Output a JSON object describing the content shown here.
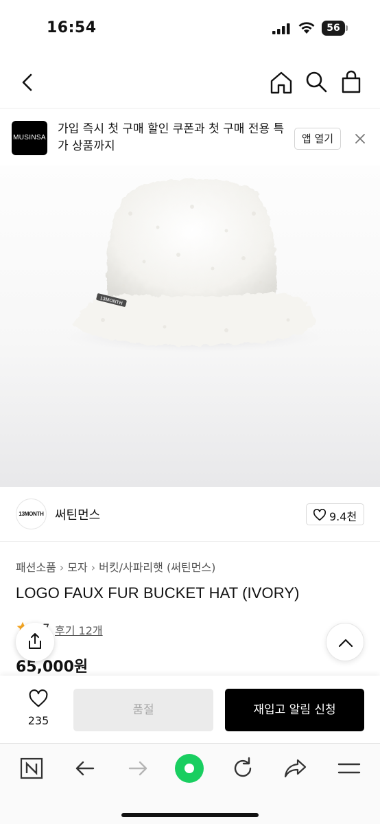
{
  "status_bar": {
    "time": "16:54",
    "battery": "56"
  },
  "header": {
    "icons": [
      "chevron-left-icon",
      "home-icon",
      "search-icon",
      "shopping-bag-icon"
    ]
  },
  "app_banner": {
    "logo_text": "MUSINSA",
    "message": "가입 즉시 첫 구매 할인 쿠폰과 첫 구매 전용 특가 상품까지",
    "open_app_label": "앱 열기"
  },
  "brand": {
    "logo_text": "13MONTH",
    "name": "써틴먼스",
    "like_count": "9.4천"
  },
  "product": {
    "breadcrumb": [
      "패션소품",
      "모자",
      "버킷/사파리햇 (써틴먼스)"
    ],
    "title": "LOGO FAUX FUR BUCKET HAT (IVORY)",
    "rating": "4.7",
    "review_link": "후기 12개",
    "price": "65,000원",
    "hat_logo_text": "13MONTH"
  },
  "purchase_bar": {
    "wish_count": "235",
    "soldout_label": "품절",
    "restock_label": "재입고 알림 신청"
  },
  "browser_toolbar": {
    "icons": [
      "naver-n-icon",
      "back-arrow-icon",
      "forward-arrow-icon",
      "green-dot-icon",
      "reload-icon",
      "share-arrow-icon",
      "menu-icon"
    ],
    "accent_color": "#19ce60"
  }
}
